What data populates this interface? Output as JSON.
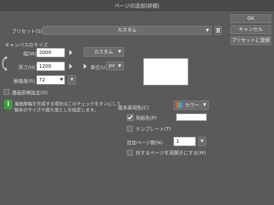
{
  "window": {
    "title": "ページの追加(詳細)"
  },
  "buttons": {
    "ok": "OK",
    "cancel": "キャンセル",
    "register_preset": "プリセットに登録"
  },
  "preset": {
    "label": "プリセット(S)",
    "value": "カスタム"
  },
  "canvas_size": {
    "section_label": "キャンバスのサイズ",
    "width_label": "幅(W)",
    "width_value": "2000",
    "height_label": "高さ(H)",
    "height_value": "1200",
    "resolution_label": "解像度(R)",
    "resolution_value": "72",
    "size_preset": "カスタム",
    "unit_label": "単位(U)",
    "unit_value": "px"
  },
  "manga_settings": {
    "label": "漫画原稿設定(O)"
  },
  "info": {
    "text_line1": "漫画原稿を作成する場合はこのチェックをオンにして",
    "text_line2": "製本のサイズや裁ち落としを指定します。"
  },
  "basic_color": {
    "label": "基本表現色(C)",
    "value": "カラー"
  },
  "paper_color": {
    "label": "用紙色(P)",
    "checked": true
  },
  "template": {
    "label": "テンプレート(T)"
  },
  "add_pages": {
    "label": "追加ページ数(N)",
    "value": "1"
  },
  "facing": {
    "label": "対するページを見開きにする(M)"
  },
  "colors": {
    "background": "#5a5a5a",
    "info_icon": "#3aa03a"
  }
}
